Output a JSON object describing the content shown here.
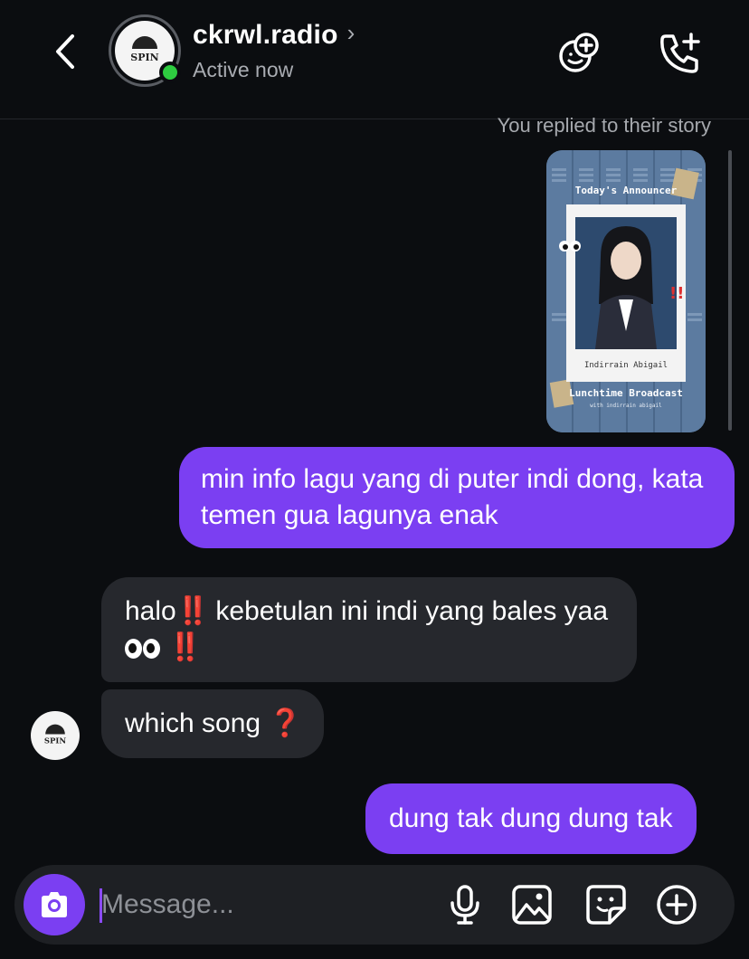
{
  "header": {
    "name": "ckrwl.radio",
    "status": "Active now",
    "avatar_text": "SPIN"
  },
  "thread": {
    "story_note": "You replied to their story",
    "story": {
      "title": "Today's Announcer",
      "caption": "Indirrain Abigail",
      "footer": "Lunchtime Broadcast",
      "footer_sub": "with indirrain abigail"
    },
    "messages": [
      {
        "from": "me",
        "text": "min info lagu yang di puter indi dong, kata temen gua lagunya enak"
      },
      {
        "from": "them",
        "part1": "halo",
        "emoji1": "‼️",
        "part2": " kebetulan ini indi yang bales yaa",
        "emoji2": "‼️"
      },
      {
        "from": "them",
        "part1": "which song ",
        "emoji1": "❓"
      },
      {
        "from": "me",
        "text": "dung tak dung dung tak"
      }
    ]
  },
  "composer": {
    "placeholder": "Message..."
  },
  "colors": {
    "accent": "#7b3ff2",
    "incoming": "#26282d",
    "background": "#0b0d10",
    "online": "#2ecc40"
  },
  "icons": [
    "back-icon",
    "add-member-icon",
    "add-call-icon",
    "camera-icon",
    "microphone-icon",
    "gallery-icon",
    "sticker-icon",
    "plus-icon"
  ]
}
